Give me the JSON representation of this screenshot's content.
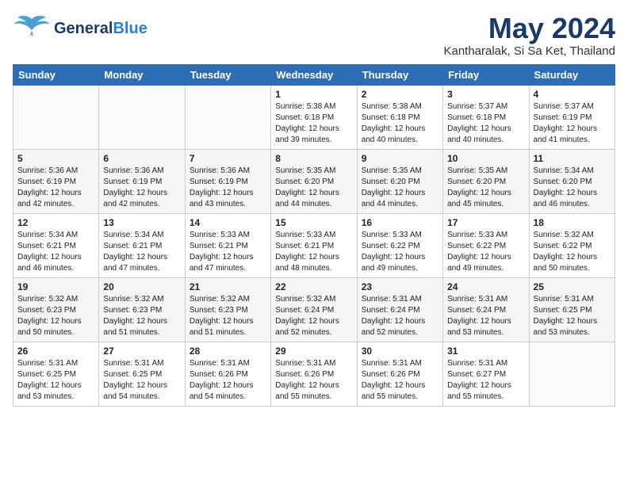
{
  "header": {
    "logo_general": "General",
    "logo_blue": "Blue",
    "month_title": "May 2024",
    "location": "Kantharalak, Si Sa Ket, Thailand"
  },
  "weekdays": [
    "Sunday",
    "Monday",
    "Tuesday",
    "Wednesday",
    "Thursday",
    "Friday",
    "Saturday"
  ],
  "weeks": [
    [
      {
        "day": "",
        "sunrise": "",
        "sunset": "",
        "daylight": ""
      },
      {
        "day": "",
        "sunrise": "",
        "sunset": "",
        "daylight": ""
      },
      {
        "day": "",
        "sunrise": "",
        "sunset": "",
        "daylight": ""
      },
      {
        "day": "1",
        "sunrise": "Sunrise: 5:38 AM",
        "sunset": "Sunset: 6:18 PM",
        "daylight": "Daylight: 12 hours and 39 minutes."
      },
      {
        "day": "2",
        "sunrise": "Sunrise: 5:38 AM",
        "sunset": "Sunset: 6:18 PM",
        "daylight": "Daylight: 12 hours and 40 minutes."
      },
      {
        "day": "3",
        "sunrise": "Sunrise: 5:37 AM",
        "sunset": "Sunset: 6:18 PM",
        "daylight": "Daylight: 12 hours and 40 minutes."
      },
      {
        "day": "4",
        "sunrise": "Sunrise: 5:37 AM",
        "sunset": "Sunset: 6:19 PM",
        "daylight": "Daylight: 12 hours and 41 minutes."
      }
    ],
    [
      {
        "day": "5",
        "sunrise": "Sunrise: 5:36 AM",
        "sunset": "Sunset: 6:19 PM",
        "daylight": "Daylight: 12 hours and 42 minutes."
      },
      {
        "day": "6",
        "sunrise": "Sunrise: 5:36 AM",
        "sunset": "Sunset: 6:19 PM",
        "daylight": "Daylight: 12 hours and 42 minutes."
      },
      {
        "day": "7",
        "sunrise": "Sunrise: 5:36 AM",
        "sunset": "Sunset: 6:19 PM",
        "daylight": "Daylight: 12 hours and 43 minutes."
      },
      {
        "day": "8",
        "sunrise": "Sunrise: 5:35 AM",
        "sunset": "Sunset: 6:20 PM",
        "daylight": "Daylight: 12 hours and 44 minutes."
      },
      {
        "day": "9",
        "sunrise": "Sunrise: 5:35 AM",
        "sunset": "Sunset: 6:20 PM",
        "daylight": "Daylight: 12 hours and 44 minutes."
      },
      {
        "day": "10",
        "sunrise": "Sunrise: 5:35 AM",
        "sunset": "Sunset: 6:20 PM",
        "daylight": "Daylight: 12 hours and 45 minutes."
      },
      {
        "day": "11",
        "sunrise": "Sunrise: 5:34 AM",
        "sunset": "Sunset: 6:20 PM",
        "daylight": "Daylight: 12 hours and 46 minutes."
      }
    ],
    [
      {
        "day": "12",
        "sunrise": "Sunrise: 5:34 AM",
        "sunset": "Sunset: 6:21 PM",
        "daylight": "Daylight: 12 hours and 46 minutes."
      },
      {
        "day": "13",
        "sunrise": "Sunrise: 5:34 AM",
        "sunset": "Sunset: 6:21 PM",
        "daylight": "Daylight: 12 hours and 47 minutes."
      },
      {
        "day": "14",
        "sunrise": "Sunrise: 5:33 AM",
        "sunset": "Sunset: 6:21 PM",
        "daylight": "Daylight: 12 hours and 47 minutes."
      },
      {
        "day": "15",
        "sunrise": "Sunrise: 5:33 AM",
        "sunset": "Sunset: 6:21 PM",
        "daylight": "Daylight: 12 hours and 48 minutes."
      },
      {
        "day": "16",
        "sunrise": "Sunrise: 5:33 AM",
        "sunset": "Sunset: 6:22 PM",
        "daylight": "Daylight: 12 hours and 49 minutes."
      },
      {
        "day": "17",
        "sunrise": "Sunrise: 5:33 AM",
        "sunset": "Sunset: 6:22 PM",
        "daylight": "Daylight: 12 hours and 49 minutes."
      },
      {
        "day": "18",
        "sunrise": "Sunrise: 5:32 AM",
        "sunset": "Sunset: 6:22 PM",
        "daylight": "Daylight: 12 hours and 50 minutes."
      }
    ],
    [
      {
        "day": "19",
        "sunrise": "Sunrise: 5:32 AM",
        "sunset": "Sunset: 6:23 PM",
        "daylight": "Daylight: 12 hours and 50 minutes."
      },
      {
        "day": "20",
        "sunrise": "Sunrise: 5:32 AM",
        "sunset": "Sunset: 6:23 PM",
        "daylight": "Daylight: 12 hours and 51 minutes."
      },
      {
        "day": "21",
        "sunrise": "Sunrise: 5:32 AM",
        "sunset": "Sunset: 6:23 PM",
        "daylight": "Daylight: 12 hours and 51 minutes."
      },
      {
        "day": "22",
        "sunrise": "Sunrise: 5:32 AM",
        "sunset": "Sunset: 6:24 PM",
        "daylight": "Daylight: 12 hours and 52 minutes."
      },
      {
        "day": "23",
        "sunrise": "Sunrise: 5:31 AM",
        "sunset": "Sunset: 6:24 PM",
        "daylight": "Daylight: 12 hours and 52 minutes."
      },
      {
        "day": "24",
        "sunrise": "Sunrise: 5:31 AM",
        "sunset": "Sunset: 6:24 PM",
        "daylight": "Daylight: 12 hours and 53 minutes."
      },
      {
        "day": "25",
        "sunrise": "Sunrise: 5:31 AM",
        "sunset": "Sunset: 6:25 PM",
        "daylight": "Daylight: 12 hours and 53 minutes."
      }
    ],
    [
      {
        "day": "26",
        "sunrise": "Sunrise: 5:31 AM",
        "sunset": "Sunset: 6:25 PM",
        "daylight": "Daylight: 12 hours and 53 minutes."
      },
      {
        "day": "27",
        "sunrise": "Sunrise: 5:31 AM",
        "sunset": "Sunset: 6:25 PM",
        "daylight": "Daylight: 12 hours and 54 minutes."
      },
      {
        "day": "28",
        "sunrise": "Sunrise: 5:31 AM",
        "sunset": "Sunset: 6:26 PM",
        "daylight": "Daylight: 12 hours and 54 minutes."
      },
      {
        "day": "29",
        "sunrise": "Sunrise: 5:31 AM",
        "sunset": "Sunset: 6:26 PM",
        "daylight": "Daylight: 12 hours and 55 minutes."
      },
      {
        "day": "30",
        "sunrise": "Sunrise: 5:31 AM",
        "sunset": "Sunset: 6:26 PM",
        "daylight": "Daylight: 12 hours and 55 minutes."
      },
      {
        "day": "31",
        "sunrise": "Sunrise: 5:31 AM",
        "sunset": "Sunset: 6:27 PM",
        "daylight": "Daylight: 12 hours and 55 minutes."
      },
      {
        "day": "",
        "sunrise": "",
        "sunset": "",
        "daylight": ""
      }
    ]
  ]
}
